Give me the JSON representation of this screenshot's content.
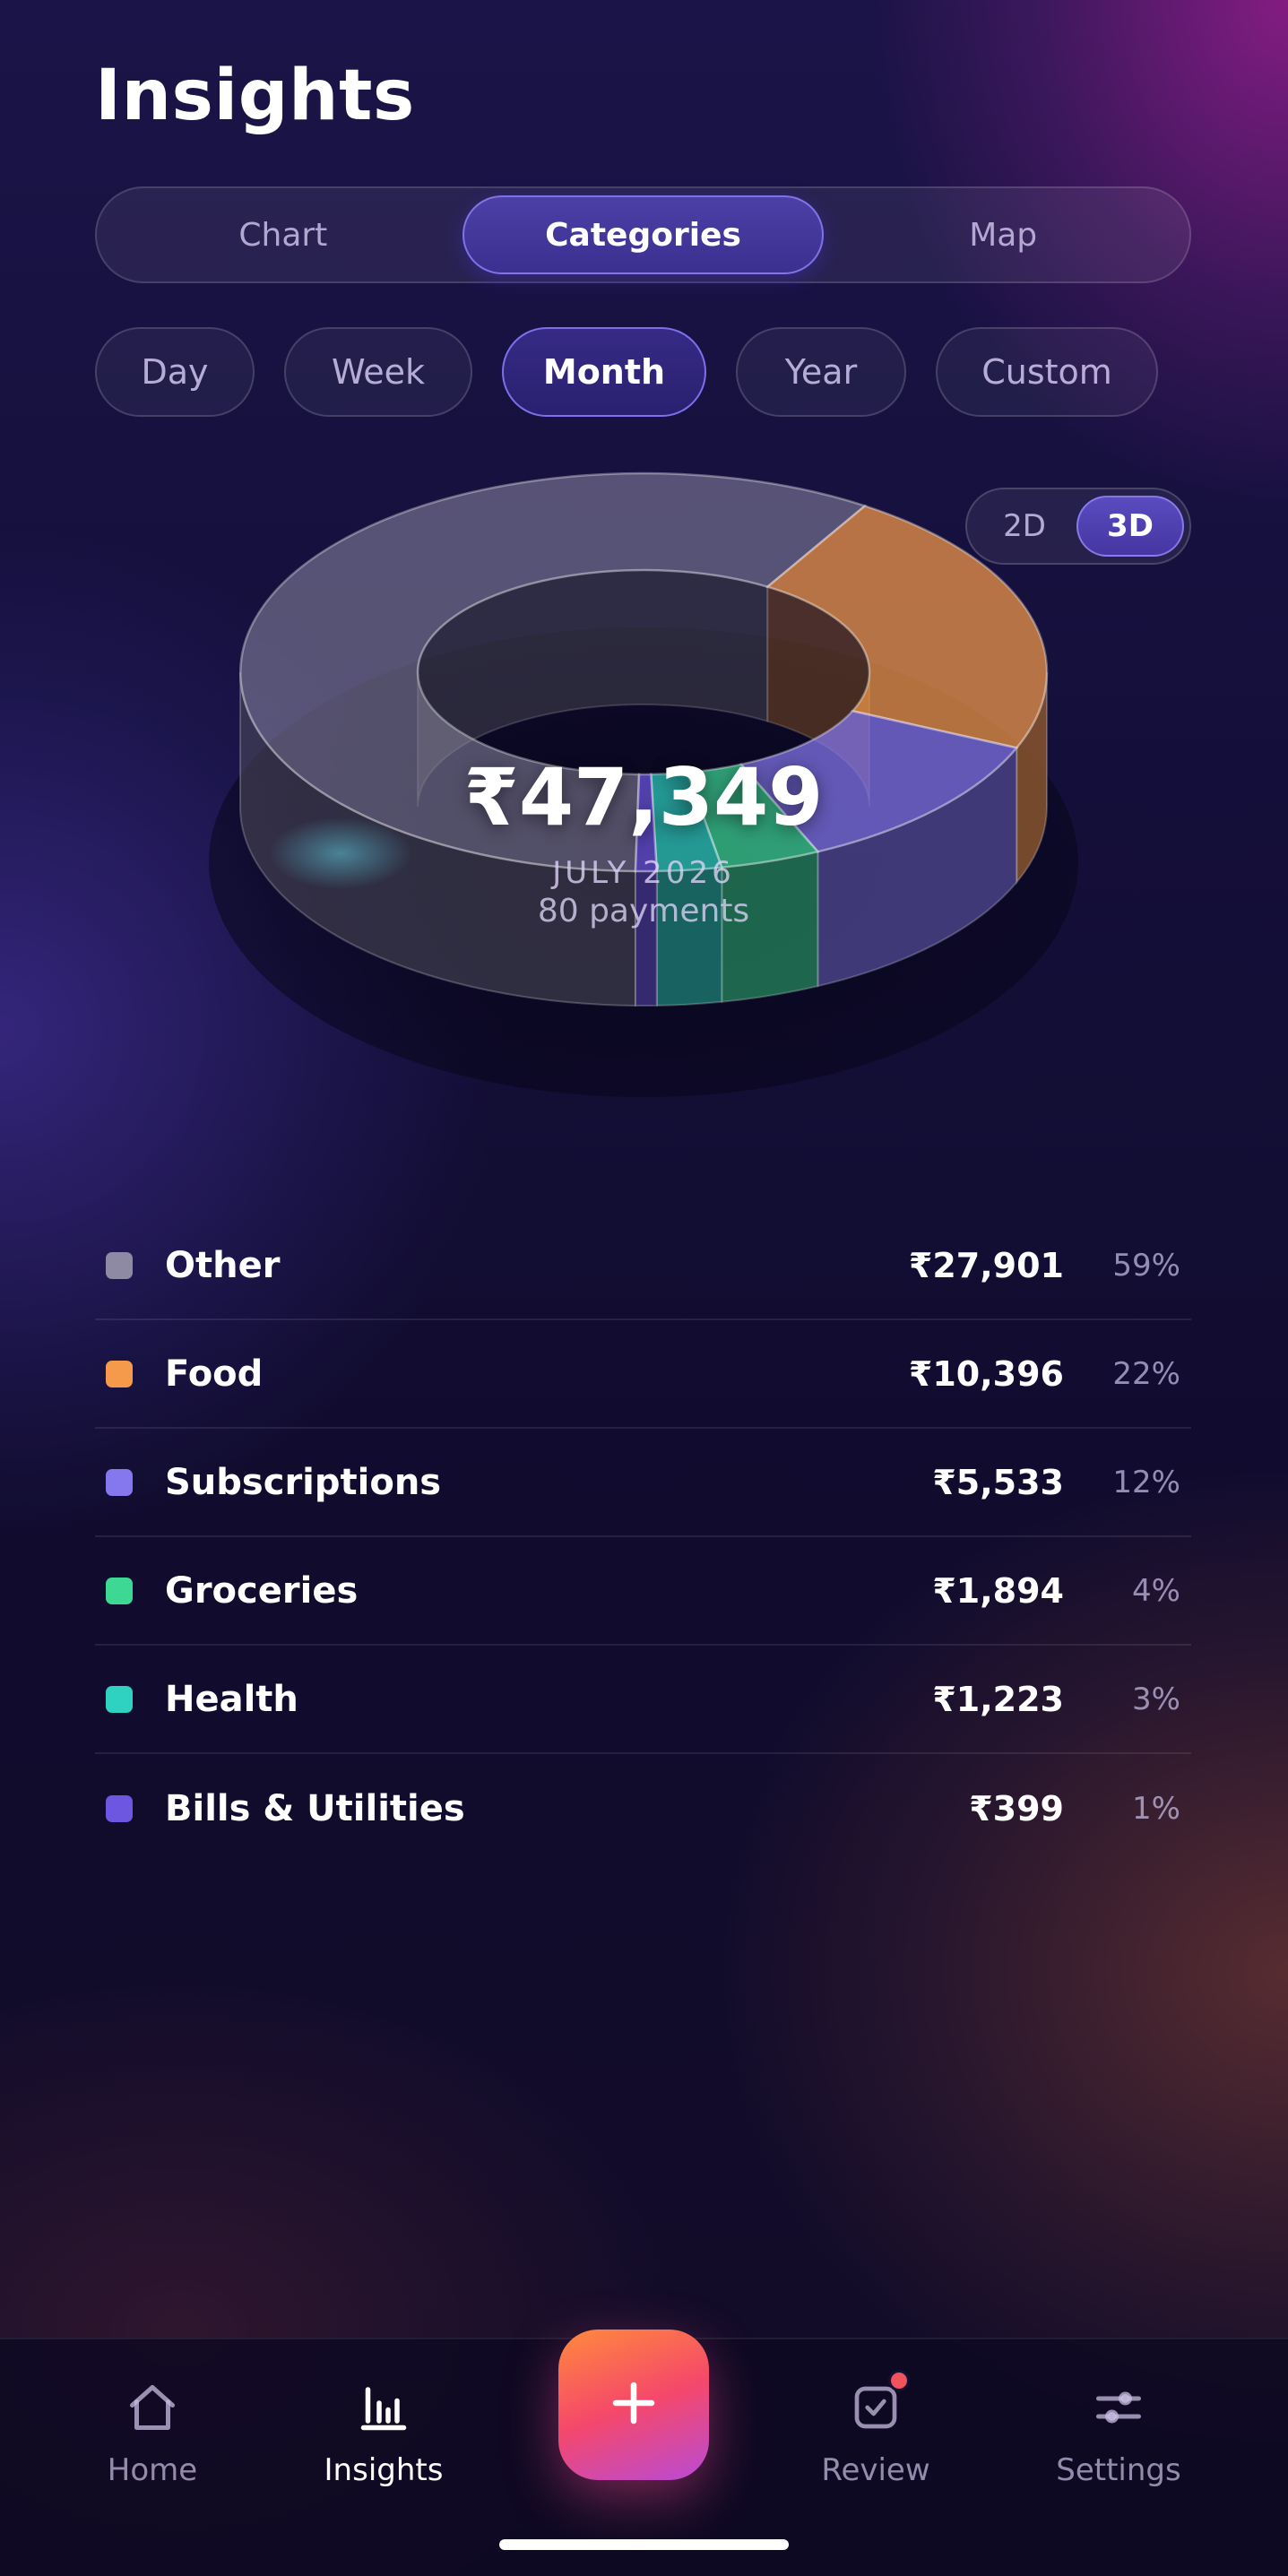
{
  "header": {
    "title": "Insights"
  },
  "view_tabs": [
    {
      "label": "Chart",
      "active": false
    },
    {
      "label": "Categories",
      "active": true
    },
    {
      "label": "Map",
      "active": false
    }
  ],
  "period_chips": [
    {
      "label": "Day",
      "active": false
    },
    {
      "label": "Week",
      "active": false
    },
    {
      "label": "Month",
      "active": true
    },
    {
      "label": "Year",
      "active": false
    },
    {
      "label": "Custom",
      "active": false
    }
  ],
  "dimension_toggle": {
    "options": [
      {
        "label": "2D",
        "active": false
      },
      {
        "label": "3D",
        "active": true
      }
    ]
  },
  "summary": {
    "total": "₹47,349",
    "month": "JULY 2026",
    "payments": "80 payments"
  },
  "chart_data": {
    "type": "pie",
    "style": "3d-donut",
    "categories": [
      "Other",
      "Food",
      "Subscriptions",
      "Groceries",
      "Health",
      "Bills & Utilities"
    ],
    "values": [
      27901,
      10396,
      5533,
      1894,
      1223,
      399
    ],
    "percentages": [
      59,
      22,
      12,
      4,
      3,
      1
    ],
    "colors": [
      "#8e8aa4",
      "#f59a4a",
      "#8577ee",
      "#3ed895",
      "#2fd1c0",
      "#6e57e0"
    ]
  },
  "legend": [
    {
      "name": "Other",
      "amount": "₹27,901",
      "pct": "59%",
      "color": "#8e8aa4"
    },
    {
      "name": "Food",
      "amount": "₹10,396",
      "pct": "22%",
      "color": "#f59a4a"
    },
    {
      "name": "Subscriptions",
      "amount": "₹5,533",
      "pct": "12%",
      "color": "#8577ee"
    },
    {
      "name": "Groceries",
      "amount": "₹1,894",
      "pct": "4%",
      "color": "#3ed895"
    },
    {
      "name": "Health",
      "amount": "₹1,223",
      "pct": "3%",
      "color": "#2fd1c0"
    },
    {
      "name": "Bills & Utilities",
      "amount": "₹399",
      "pct": "1%",
      "color": "#6e57e0"
    }
  ],
  "bottom_nav": {
    "items": [
      {
        "label": "Home",
        "icon": "home-icon",
        "active": false
      },
      {
        "label": "Insights",
        "icon": "bar-chart-icon",
        "active": true
      },
      {
        "label": "Review",
        "icon": "check-square-icon",
        "active": false,
        "badge": true
      },
      {
        "label": "Settings",
        "icon": "sliders-icon",
        "active": false
      }
    ],
    "fab_icon": "plus-icon"
  }
}
